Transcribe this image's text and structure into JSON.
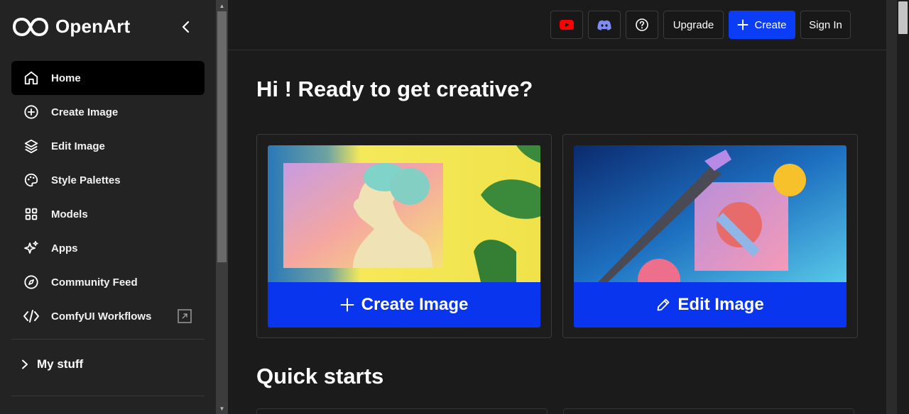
{
  "brand": {
    "name": "OpenArt"
  },
  "sidebar": {
    "items": [
      {
        "label": "Home",
        "icon": "home-icon",
        "active": true
      },
      {
        "label": "Create Image",
        "icon": "plus-circle-icon"
      },
      {
        "label": "Edit Image",
        "icon": "layers-icon"
      },
      {
        "label": "Style Palettes",
        "icon": "palette-icon"
      },
      {
        "label": "Models",
        "icon": "grid-icon"
      },
      {
        "label": "Apps",
        "icon": "sparkles-icon"
      },
      {
        "label": "Community Feed",
        "icon": "compass-icon"
      },
      {
        "label": "ComfyUI Workflows",
        "icon": "code-icon",
        "external": true
      }
    ],
    "my_stuff": "My stuff"
  },
  "header": {
    "youtube_icon": "youtube-icon",
    "discord_icon": "discord-icon",
    "help_icon": "help-icon",
    "upgrade": "Upgrade",
    "create": "Create",
    "sign_in": "Sign In"
  },
  "main": {
    "greeting": "Hi ! Ready to get creative?",
    "cards": [
      {
        "label": "Create Image",
        "icon": "plus-icon"
      },
      {
        "label": "Edit Image",
        "icon": "pencil-icon"
      }
    ],
    "quick_starts": "Quick starts"
  },
  "colors": {
    "accent": "#0a3df5",
    "sidebar_bg": "#232323",
    "main_bg": "#1b1b1b",
    "active_bg": "#000000"
  }
}
